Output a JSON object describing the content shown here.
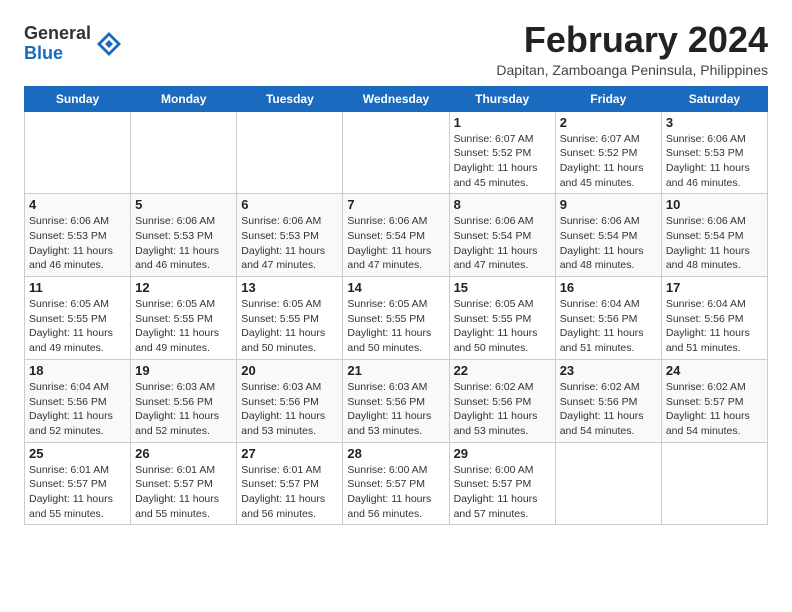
{
  "logo": {
    "general": "General",
    "blue": "Blue"
  },
  "title": "February 2024",
  "subtitle": "Dapitan, Zamboanga Peninsula, Philippines",
  "days_of_week": [
    "Sunday",
    "Monday",
    "Tuesday",
    "Wednesday",
    "Thursday",
    "Friday",
    "Saturday"
  ],
  "weeks": [
    [
      {
        "day": "",
        "info": ""
      },
      {
        "day": "",
        "info": ""
      },
      {
        "day": "",
        "info": ""
      },
      {
        "day": "",
        "info": ""
      },
      {
        "day": "1",
        "info": "Sunrise: 6:07 AM\nSunset: 5:52 PM\nDaylight: 11 hours and 45 minutes."
      },
      {
        "day": "2",
        "info": "Sunrise: 6:07 AM\nSunset: 5:52 PM\nDaylight: 11 hours and 45 minutes."
      },
      {
        "day": "3",
        "info": "Sunrise: 6:06 AM\nSunset: 5:53 PM\nDaylight: 11 hours and 46 minutes."
      }
    ],
    [
      {
        "day": "4",
        "info": "Sunrise: 6:06 AM\nSunset: 5:53 PM\nDaylight: 11 hours and 46 minutes."
      },
      {
        "day": "5",
        "info": "Sunrise: 6:06 AM\nSunset: 5:53 PM\nDaylight: 11 hours and 46 minutes."
      },
      {
        "day": "6",
        "info": "Sunrise: 6:06 AM\nSunset: 5:53 PM\nDaylight: 11 hours and 47 minutes."
      },
      {
        "day": "7",
        "info": "Sunrise: 6:06 AM\nSunset: 5:54 PM\nDaylight: 11 hours and 47 minutes."
      },
      {
        "day": "8",
        "info": "Sunrise: 6:06 AM\nSunset: 5:54 PM\nDaylight: 11 hours and 47 minutes."
      },
      {
        "day": "9",
        "info": "Sunrise: 6:06 AM\nSunset: 5:54 PM\nDaylight: 11 hours and 48 minutes."
      },
      {
        "day": "10",
        "info": "Sunrise: 6:06 AM\nSunset: 5:54 PM\nDaylight: 11 hours and 48 minutes."
      }
    ],
    [
      {
        "day": "11",
        "info": "Sunrise: 6:05 AM\nSunset: 5:55 PM\nDaylight: 11 hours and 49 minutes."
      },
      {
        "day": "12",
        "info": "Sunrise: 6:05 AM\nSunset: 5:55 PM\nDaylight: 11 hours and 49 minutes."
      },
      {
        "day": "13",
        "info": "Sunrise: 6:05 AM\nSunset: 5:55 PM\nDaylight: 11 hours and 50 minutes."
      },
      {
        "day": "14",
        "info": "Sunrise: 6:05 AM\nSunset: 5:55 PM\nDaylight: 11 hours and 50 minutes."
      },
      {
        "day": "15",
        "info": "Sunrise: 6:05 AM\nSunset: 5:55 PM\nDaylight: 11 hours and 50 minutes."
      },
      {
        "day": "16",
        "info": "Sunrise: 6:04 AM\nSunset: 5:56 PM\nDaylight: 11 hours and 51 minutes."
      },
      {
        "day": "17",
        "info": "Sunrise: 6:04 AM\nSunset: 5:56 PM\nDaylight: 11 hours and 51 minutes."
      }
    ],
    [
      {
        "day": "18",
        "info": "Sunrise: 6:04 AM\nSunset: 5:56 PM\nDaylight: 11 hours and 52 minutes."
      },
      {
        "day": "19",
        "info": "Sunrise: 6:03 AM\nSunset: 5:56 PM\nDaylight: 11 hours and 52 minutes."
      },
      {
        "day": "20",
        "info": "Sunrise: 6:03 AM\nSunset: 5:56 PM\nDaylight: 11 hours and 53 minutes."
      },
      {
        "day": "21",
        "info": "Sunrise: 6:03 AM\nSunset: 5:56 PM\nDaylight: 11 hours and 53 minutes."
      },
      {
        "day": "22",
        "info": "Sunrise: 6:02 AM\nSunset: 5:56 PM\nDaylight: 11 hours and 53 minutes."
      },
      {
        "day": "23",
        "info": "Sunrise: 6:02 AM\nSunset: 5:56 PM\nDaylight: 11 hours and 54 minutes."
      },
      {
        "day": "24",
        "info": "Sunrise: 6:02 AM\nSunset: 5:57 PM\nDaylight: 11 hours and 54 minutes."
      }
    ],
    [
      {
        "day": "25",
        "info": "Sunrise: 6:01 AM\nSunset: 5:57 PM\nDaylight: 11 hours and 55 minutes."
      },
      {
        "day": "26",
        "info": "Sunrise: 6:01 AM\nSunset: 5:57 PM\nDaylight: 11 hours and 55 minutes."
      },
      {
        "day": "27",
        "info": "Sunrise: 6:01 AM\nSunset: 5:57 PM\nDaylight: 11 hours and 56 minutes."
      },
      {
        "day": "28",
        "info": "Sunrise: 6:00 AM\nSunset: 5:57 PM\nDaylight: 11 hours and 56 minutes."
      },
      {
        "day": "29",
        "info": "Sunrise: 6:00 AM\nSunset: 5:57 PM\nDaylight: 11 hours and 57 minutes."
      },
      {
        "day": "",
        "info": ""
      },
      {
        "day": "",
        "info": ""
      }
    ]
  ]
}
